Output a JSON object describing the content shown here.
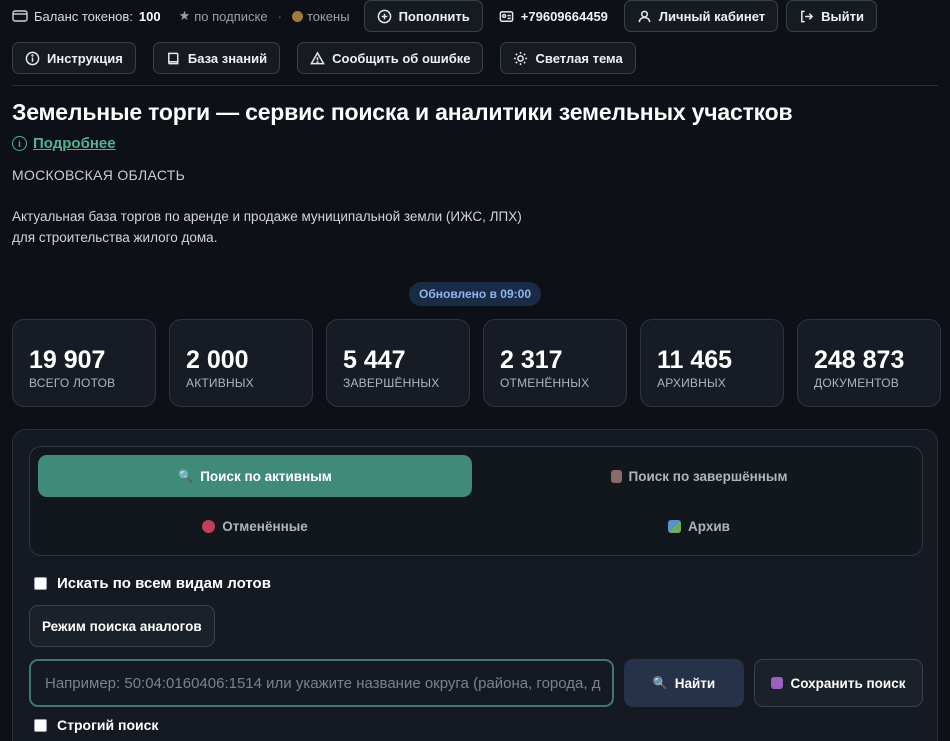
{
  "topbar": {
    "balance_label": "Баланс токенов:",
    "balance_value": "100",
    "subscription": "по подписке",
    "tokens": "токены",
    "topup": "Пополнить",
    "phone": "+79609664459",
    "cabinet": "Личный кабинет",
    "logout": "Выйти"
  },
  "toolbar": {
    "instruction": "Инструкция",
    "knowledge": "База знаний",
    "report": "Сообщить об ошибке",
    "theme": "Светлая тема"
  },
  "header": {
    "title": "Земельные торги — сервис поиска и аналитики земельных участков",
    "more_link": "Подробнее",
    "region": "МОСКОВСКАЯ ОБЛАСТЬ",
    "description": "Актуальная база торгов по аренде и продаже муниципальной земли (ИЖС, ЛПХ) для строительства жилого дома.",
    "updated": "Обновлено в 09:00"
  },
  "stats": [
    {
      "value": "19 907",
      "label": "ВСЕГО ЛОТОВ"
    },
    {
      "value": "2 000",
      "label": "АКТИВНЫХ"
    },
    {
      "value": "5 447",
      "label": "ЗАВЕРШЁННЫХ"
    },
    {
      "value": "2 317",
      "label": "ОТМЕНЁННЫХ"
    },
    {
      "value": "11 465",
      "label": "АРХИВНЫХ"
    },
    {
      "value": "248 873",
      "label": "ДОКУМЕНТОВ"
    }
  ],
  "search": {
    "tabs": [
      "Поиск по активным",
      "Поиск по завершённым",
      "Отменённые",
      "Архив"
    ],
    "all_types_label": "Искать по всем видам лотов",
    "analog_mode": "Режим поиска аналогов",
    "placeholder": "Например: 50:04:0160406:1514 или укажите название округа (района, города, д",
    "find": "Найти",
    "save": "Сохранить поиск",
    "strict": "Строгий поиск"
  },
  "colors": {
    "background": "#0d1117",
    "accent": "#3f8a78",
    "link": "#4fb38f",
    "badge": "#1a2b45"
  }
}
